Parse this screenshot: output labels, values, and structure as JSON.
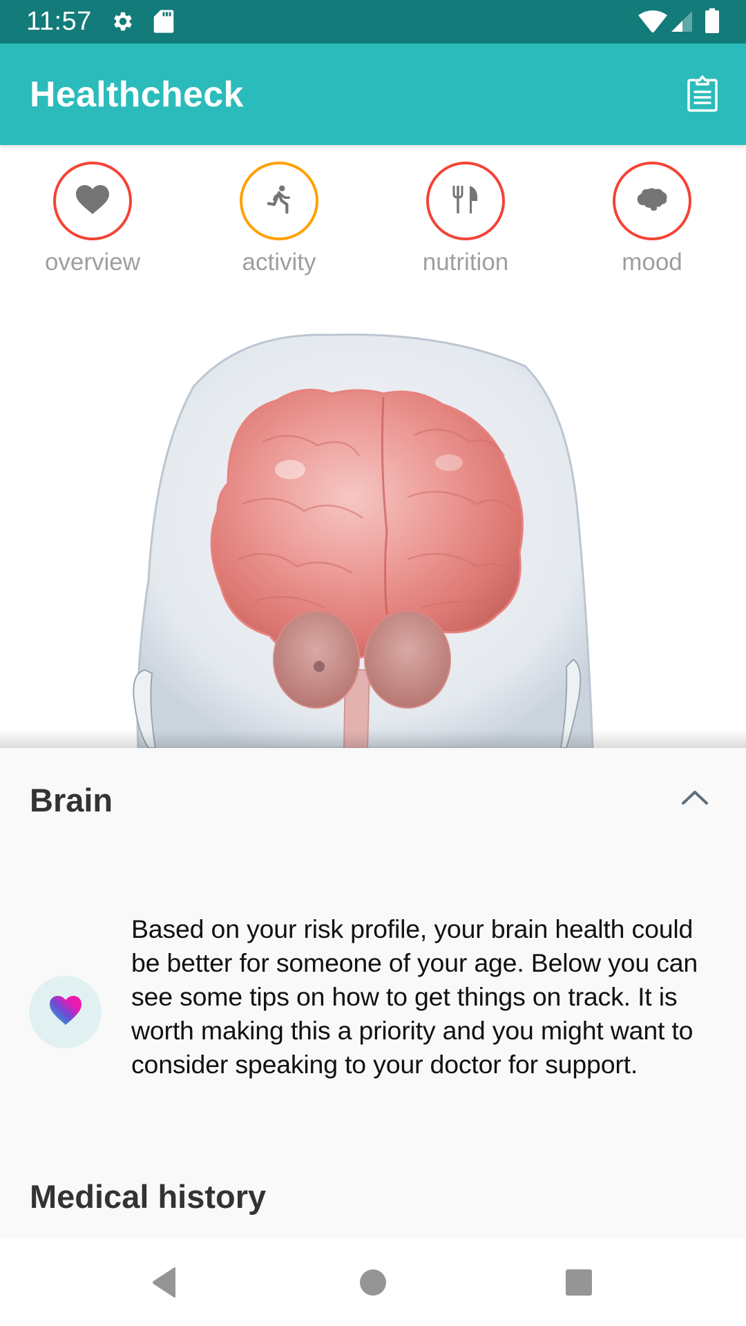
{
  "status_bar": {
    "time": "11:57",
    "left_icons": [
      "gear-icon",
      "sd-card-icon"
    ],
    "right_icons": [
      "wifi-icon",
      "cell-signal-icon",
      "battery-icon"
    ]
  },
  "app_bar": {
    "title": "Healthcheck",
    "action_icon": "clipboard-report-icon"
  },
  "tabs": [
    {
      "label": "overview",
      "icon": "heart-icon",
      "ring_color": "#f44336"
    },
    {
      "label": "activity",
      "icon": "running-person-icon",
      "ring_color": "#ffa000"
    },
    {
      "label": "nutrition",
      "icon": "fork-knife-icon",
      "ring_color": "#f44336"
    },
    {
      "label": "mood",
      "icon": "brain-icon",
      "ring_color": "#f44336"
    }
  ],
  "viewer": {
    "subject": "3D head model with highlighted brain"
  },
  "sheet": {
    "title": "Brain",
    "toggle_icon": "chevron-up-icon",
    "message": "Based on your risk profile, your brain health could be better for someone of your age. Below you can see some tips on how to get things on track. It is worth making this a priority and you might want to consider speaking to your doctor for support.",
    "avatar_icon": "gradient-heart-icon",
    "next_section_title": "Medical history"
  },
  "nav_bar": {
    "buttons": [
      "back",
      "home",
      "recents"
    ]
  },
  "colors": {
    "status_bar": "#137b79",
    "app_bar": "#2cbbbb",
    "alert_ring": "#f44336",
    "warning_ring": "#ffa000",
    "tab_label": "#9e9e9e",
    "sheet_bg": "#f9f9f9"
  }
}
